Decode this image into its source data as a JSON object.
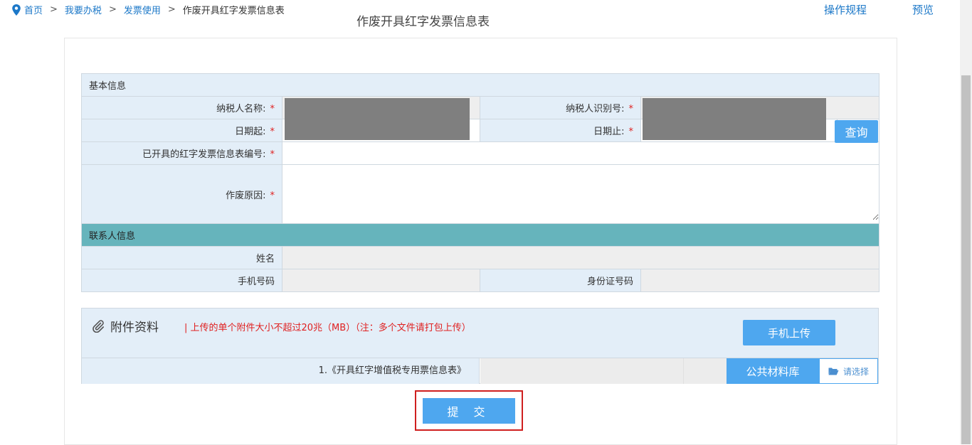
{
  "breadcrumb": {
    "items": [
      "首页",
      "我要办税",
      "发票使用",
      "作废开具红字发票信息表"
    ],
    "separator": ">"
  },
  "header_links": {
    "ops": "操作规程",
    "preview": "预览"
  },
  "form": {
    "title": "作废开具红字发票信息表",
    "basic_section": "基本信息",
    "required_mark": "*",
    "taxpayer_name_label": "纳税人名称:",
    "taxpayer_id_label": "纳税人识别号:",
    "date_start_label": "日期起:",
    "date_end_label": "日期止:",
    "query_button": "查询",
    "red_invoice_no_label": "已开具的红字发票信息表编号:",
    "red_invoice_no_value": "",
    "void_reason_label": "作废原因:",
    "void_reason_value": "",
    "contact_section": "联系人信息",
    "name_label": "姓名",
    "phone_label": "手机号码",
    "idcard_label": "身份证号码"
  },
  "attachments": {
    "title": "附件资料",
    "note": "| 上传的单个附件大小不超过20兆（MB）（注：多个文件请打包上传）",
    "mobile_upload_button": "手机上传",
    "items": [
      {
        "label": "1.《开具红字增值税专用票信息表》"
      }
    ],
    "public_library_button": "公共材料库",
    "choose_button": "请选择"
  },
  "submit_button": "提 交",
  "colors": {
    "accent": "#4ea7ef",
    "link": "#1c78c8",
    "label_bg": "#e3eef8",
    "contact_header_bg": "#66b4bc",
    "required": "#e02020",
    "highlight_frame": "#cf1f1f"
  }
}
